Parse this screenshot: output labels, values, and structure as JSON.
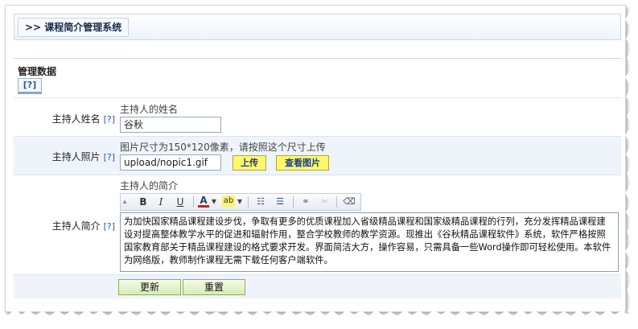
{
  "header": {
    "title": ">> 课程简介管理系统"
  },
  "section": {
    "title": "管理数据",
    "help": "[?]"
  },
  "fields": {
    "host_name": {
      "label": "主持人姓名",
      "help": "[?]",
      "hint": "主持人的姓名",
      "value": "谷秋"
    },
    "host_photo": {
      "label": "主持人照片",
      "help": "[?]",
      "hint": "图片尺寸为150*120像素，请按照这个尺寸上传",
      "value": "upload/nopic1.gif",
      "upload_label": "上传",
      "view_label": "查看图片"
    },
    "host_intro": {
      "label": "主持人简介",
      "help": "[?]",
      "hint": "主持人的简介",
      "toolbar": {
        "bold": "B",
        "italic": "I",
        "underline": "U",
        "font_color": "A",
        "highlight": "ab"
      },
      "content": "为加快国家精品课程建设步伐，争取有更多的优质课程加入省级精品课程和国家级精品课程的行列，充分发挥精品课程建设对提高整体教学水平的促进和辐射作用，整合学校教师的教学资源。现推出《谷秋精品课程软件》系统，软件严格按照国家教育部关于精品课程建设的格式要求开发。界面简洁大方，操作容易，只需具备一些Word操作即可轻松使用。本软件为网络版，教师制作课程无需下载任何客户端软件。"
    }
  },
  "actions": {
    "update_label": "更新",
    "reset_label": "重置"
  }
}
